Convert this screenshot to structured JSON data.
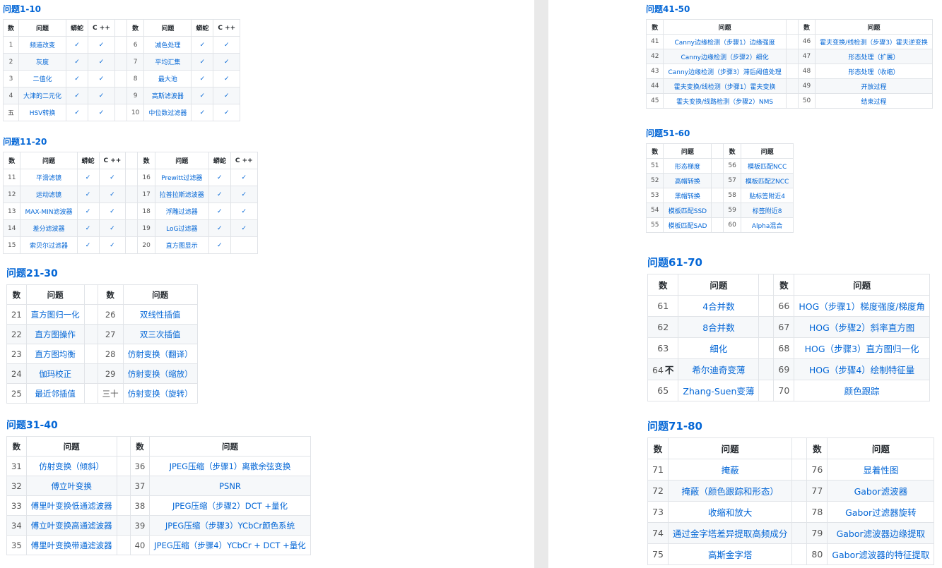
{
  "sections": [
    {
      "title": "问题1-10",
      "hdr": {
        "num": "数",
        "q": "问题",
        "py": "蟒蛇",
        "cpp": "C ++"
      },
      "left": [
        {
          "n": "1",
          "q": "频道改变",
          "py": "✓",
          "cpp": "✓"
        },
        {
          "n": "2",
          "q": "灰度",
          "py": "✓",
          "cpp": "✓"
        },
        {
          "n": "3",
          "q": "二值化",
          "py": "✓",
          "cpp": "✓"
        },
        {
          "n": "4",
          "q": "大津的二元化",
          "py": "✓",
          "cpp": "✓"
        },
        {
          "n": "五",
          "q": "HSV转换",
          "py": "✓",
          "cpp": "✓"
        }
      ],
      "right": [
        {
          "n": "6",
          "q": "减色处理",
          "py": "✓",
          "cpp": "✓"
        },
        {
          "n": "7",
          "q": "平均汇集",
          "py": "✓",
          "cpp": "✓"
        },
        {
          "n": "8",
          "q": "最大池",
          "py": "✓",
          "cpp": "✓"
        },
        {
          "n": "9",
          "q": "高斯滤波器",
          "py": "✓",
          "cpp": "✓"
        },
        {
          "n": "10",
          "q": "中位数过滤器",
          "py": "✓",
          "cpp": "✓"
        }
      ]
    },
    {
      "title": "问题11-20",
      "hdr": {
        "num": "数",
        "q": "问题",
        "py": "蟒蛇",
        "cpp": "C ++"
      },
      "left": [
        {
          "n": "11",
          "q": "平滑滤镜",
          "py": "✓",
          "cpp": "✓"
        },
        {
          "n": "12",
          "q": "运动滤镜",
          "py": "✓",
          "cpp": "✓"
        },
        {
          "n": "13",
          "q": "MAX-MIN滤波器",
          "py": "✓",
          "cpp": "✓"
        },
        {
          "n": "14",
          "q": "差分滤波器",
          "py": "✓",
          "cpp": "✓"
        },
        {
          "n": "15",
          "q": "索贝尔过滤器",
          "py": "✓",
          "cpp": "✓"
        }
      ],
      "right": [
        {
          "n": "16",
          "q": "Prewitt过滤器",
          "py": "✓",
          "cpp": "✓"
        },
        {
          "n": "17",
          "q": "拉普拉斯滤波器",
          "py": "✓",
          "cpp": "✓"
        },
        {
          "n": "18",
          "q": "浮雕过滤器",
          "py": "✓",
          "cpp": "✓"
        },
        {
          "n": "19",
          "q": "LoG过滤器",
          "py": "✓",
          "cpp": "✓"
        },
        {
          "n": "20",
          "q": "直方图显示",
          "py": "✓",
          "cpp": ""
        }
      ]
    },
    {
      "title": "问题21-30",
      "hdr": {
        "num": "数",
        "q": "问题"
      },
      "left": [
        {
          "n": "21",
          "q": "直方图归一化"
        },
        {
          "n": "22",
          "q": "直方图操作"
        },
        {
          "n": "23",
          "q": "直方图均衡"
        },
        {
          "n": "24",
          "q": "伽玛校正"
        },
        {
          "n": "25",
          "q": "最近邻插值"
        }
      ],
      "right": [
        {
          "n": "26",
          "q": "双线性插值"
        },
        {
          "n": "27",
          "q": "双三次插值"
        },
        {
          "n": "28",
          "q": "仿射变换（翻译）"
        },
        {
          "n": "29",
          "q": "仿射变换（缩放）"
        },
        {
          "n": "三十",
          "q": "仿射变换（旋转）"
        }
      ]
    },
    {
      "title": "问题31-40",
      "hdr": {
        "num": "数",
        "q": "问题"
      },
      "left": [
        {
          "n": "31",
          "q": "仿射变换（倾斜）"
        },
        {
          "n": "32",
          "q": "傅立叶变换"
        },
        {
          "n": "33",
          "q": "傅里叶变换低通滤波器"
        },
        {
          "n": "34",
          "q": "傅立叶变换高通滤波器"
        },
        {
          "n": "35",
          "q": "傅里叶变换带通滤波器"
        }
      ],
      "right": [
        {
          "n": "36",
          "q": "JPEG压缩（步骤1）离散余弦变换"
        },
        {
          "n": "37",
          "q": "PSNR"
        },
        {
          "n": "38",
          "q": "JPEG压缩（步骤2）DCT +量化"
        },
        {
          "n": "39",
          "q": "JPEG压缩（步骤3）YCbCr颜色系统"
        },
        {
          "n": "40",
          "q": "JPEG压缩（步骤4）YCbCr + DCT +量化"
        }
      ]
    },
    {
      "title": "问题41-50",
      "hdr": {
        "num": "数",
        "q": "问题"
      },
      "left": [
        {
          "n": "41",
          "q": "Canny边缘检测（步骤1）边缘强度"
        },
        {
          "n": "42",
          "q": "Canny边缘检测（步骤2）细化"
        },
        {
          "n": "43",
          "q": "Canny边缘检测（步骤3）滞后阈值处理"
        },
        {
          "n": "44",
          "q": "霍夫变换/线检测（步骤1）霍夫变换"
        },
        {
          "n": "45",
          "q": "霍夫变换/线路检测（步骤2）NMS"
        }
      ],
      "right": [
        {
          "n": "46",
          "q": "霍夫变换/线检测（步骤3）霍夫逆变换"
        },
        {
          "n": "47",
          "q": "形态处理（扩展）"
        },
        {
          "n": "48",
          "q": "形态处理（收缩）"
        },
        {
          "n": "49",
          "q": "开放过程"
        },
        {
          "n": "50",
          "q": "结束过程"
        }
      ]
    },
    {
      "title": "问题51-60",
      "hdr": {
        "num": "数",
        "q": "问题"
      },
      "left": [
        {
          "n": "51",
          "q": "形态梯度"
        },
        {
          "n": "52",
          "q": "高帽转换"
        },
        {
          "n": "53",
          "q": "黑帽转换"
        },
        {
          "n": "54",
          "q": "模板匹配SSD"
        },
        {
          "n": "55",
          "q": "模板匹配SAD"
        }
      ],
      "right": [
        {
          "n": "56",
          "q": "模板匹配NCC"
        },
        {
          "n": "57",
          "q": "模板匹配ZNCC"
        },
        {
          "n": "58",
          "q": "贴标签附近4"
        },
        {
          "n": "59",
          "q": "标签附近8"
        },
        {
          "n": "60",
          "q": "Alpha混合"
        }
      ]
    },
    {
      "title": "问题61-70",
      "hdr": {
        "num": "数",
        "q": "问题"
      },
      "left": [
        {
          "n": "61",
          "q": "4合并数"
        },
        {
          "n": "62",
          "q": "8合并数"
        },
        {
          "n": "63",
          "q": "细化"
        },
        {
          "n": "64",
          "mark": "不",
          "q": "希尔迪奇变薄"
        },
        {
          "n": "65",
          "q": "Zhang-Suen变薄"
        }
      ],
      "right": [
        {
          "n": "66",
          "q": "HOG（步骤1）梯度强度/梯度角"
        },
        {
          "n": "67",
          "q": "HOG（步骤2）斜率直方图"
        },
        {
          "n": "68",
          "q": "HOG（步骤3）直方图归一化"
        },
        {
          "n": "69",
          "q": "HOG（步骤4）绘制特征量"
        },
        {
          "n": "70",
          "q": "颜色跟踪"
        }
      ]
    },
    {
      "title": "问题71-80",
      "hdr": {
        "num": "数",
        "q": "问题"
      },
      "left": [
        {
          "n": "71",
          "q": "掩蔽"
        },
        {
          "n": "72",
          "q": "掩蔽（颜色跟踪和形态）"
        },
        {
          "n": "73",
          "q": "收缩和放大"
        },
        {
          "n": "74",
          "q": "通过金字塔差异提取高频成分"
        },
        {
          "n": "75",
          "q": "高斯金字塔"
        }
      ],
      "right": [
        {
          "n": "76",
          "q": "显着性图"
        },
        {
          "n": "77",
          "q": "Gabor滤波器"
        },
        {
          "n": "78",
          "q": "Gabor过滤器旋转"
        },
        {
          "n": "79",
          "q": "Gabor滤波器边缘提取"
        },
        {
          "n": "80",
          "q": "Gabor滤波器的特征提取"
        }
      ]
    }
  ]
}
